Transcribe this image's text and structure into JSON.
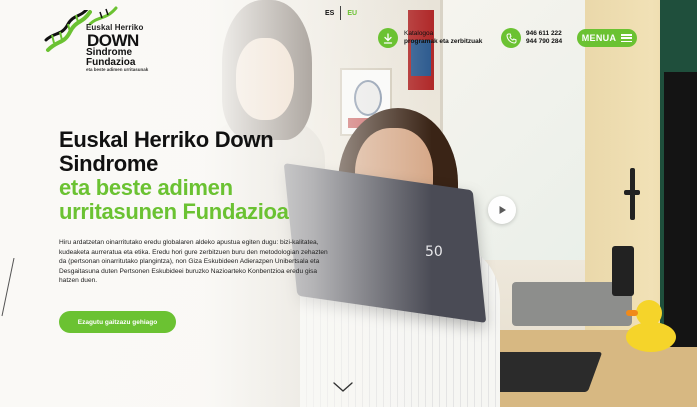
{
  "header": {
    "logo": {
      "line1": "Euskal Herriko",
      "line2": "DOWN",
      "line3": "Sindrome",
      "line4": "Fundazioa",
      "line5": "eta beste adimen urritasunak"
    },
    "languages": {
      "es": "ES",
      "eu": "EU",
      "active": "EU"
    },
    "catalog": {
      "line1": "Katalogoa",
      "line2": "programak eta zerbitzuak",
      "icon": "download-icon"
    },
    "phones": {
      "line1": "946 611 222",
      "line2": "944 790 284",
      "icon": "phone-icon"
    },
    "menu_label": "MENUA"
  },
  "hero": {
    "title_line1": "Euskal Herriko Down",
    "title_line2": "Sindrome",
    "title_green1": "eta beste adimen",
    "title_green2": "urritasunen Fundazioa",
    "description": "Hiru ardatzetan oinarritutako eredu globalaren aldeko apustua egiten dugu: bizi-kalitatea, kudeaketa aurreratua eta etika. Eredu hori gure zerbitzuen buru den metodologian zehazten da (pertsonan oinarritutako plangintza), non Giza Eskubideen Adierazpen Unibertsala eta Desgaitasuna duten Pertsonen Eskubideei buruzko Nazioarteko Konbentzioa eredu gisa hatzen duen.",
    "cta_label": "Ezagutu gaitzazu gehiago"
  },
  "photo": {
    "brochure_number": "50"
  },
  "colors": {
    "accent": "#6bc232",
    "text": "#111111"
  }
}
